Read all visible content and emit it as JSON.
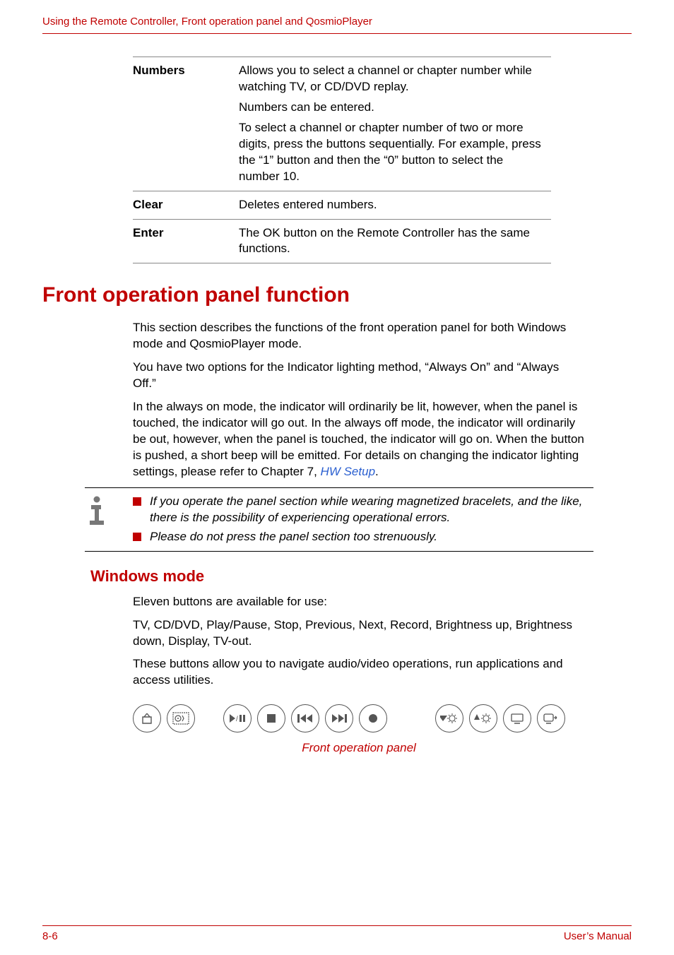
{
  "header": "Using the Remote Controller, Front operation panel and QosmioPlayer",
  "table": {
    "rows": [
      {
        "label": "Numbers",
        "paras": [
          "Allows you to select a channel or chapter number while watching TV, or CD/DVD replay.",
          "Numbers can be entered.",
          "To select a channel or chapter number of two or more digits, press the buttons sequentially. For example, press the “1” button and then the “0” button to select the number 10."
        ]
      },
      {
        "label": "Clear",
        "paras": [
          "Deletes entered numbers."
        ]
      },
      {
        "label": "Enter",
        "paras": [
          "The OK button on the Remote Controller has the same functions."
        ]
      }
    ]
  },
  "section_title": "Front operation panel function",
  "section_paras": [
    "This section describes the functions of the front operation panel for both Windows mode and QosmioPlayer mode.",
    "You have two options for the Indicator lighting method, “Always On” and “Always Off.”"
  ],
  "section_para_with_link_pre": "In the always on mode, the indicator will ordinarily be lit, however, when the panel is touched, the indicator will go out. In the always off mode, the indicator will ordinarily be out, however, when the panel is touched, the indicator will go on. When the button is pushed, a short beep will be emitted. For details on changing the indicator lighting settings, please refer to Chapter 7, ",
  "section_link": "HW Setup",
  "section_para_with_link_post": ".",
  "notes": [
    "If you operate the panel section while wearing magnetized bracelets, and the like, there is the possibility of experiencing operational errors.",
    "Please do not press the panel section too strenuously."
  ],
  "subsection_title": "Windows mode",
  "subsection_paras": [
    "Eleven buttons are available for use:",
    "TV, CD/DVD, Play/Pause, Stop, Previous, Next, Record, Brightness up, Brightness down, Display, TV-out.",
    "These buttons allow you to navigate audio/video operations, run applications and access utilities."
  ],
  "panel_caption": "Front operation panel",
  "footer_left": "8-6",
  "footer_right": "User’s Manual",
  "icons": {
    "tv": "tv-icon",
    "cddvd": "cddvd-icon",
    "playpause": "play-pause-icon",
    "stop": "stop-icon",
    "previous": "previous-icon",
    "next": "next-icon",
    "record": "record-icon",
    "brightdown": "brightness-down-icon",
    "brightup": "brightness-up-icon",
    "display": "display-icon",
    "tvout": "tv-out-icon"
  }
}
